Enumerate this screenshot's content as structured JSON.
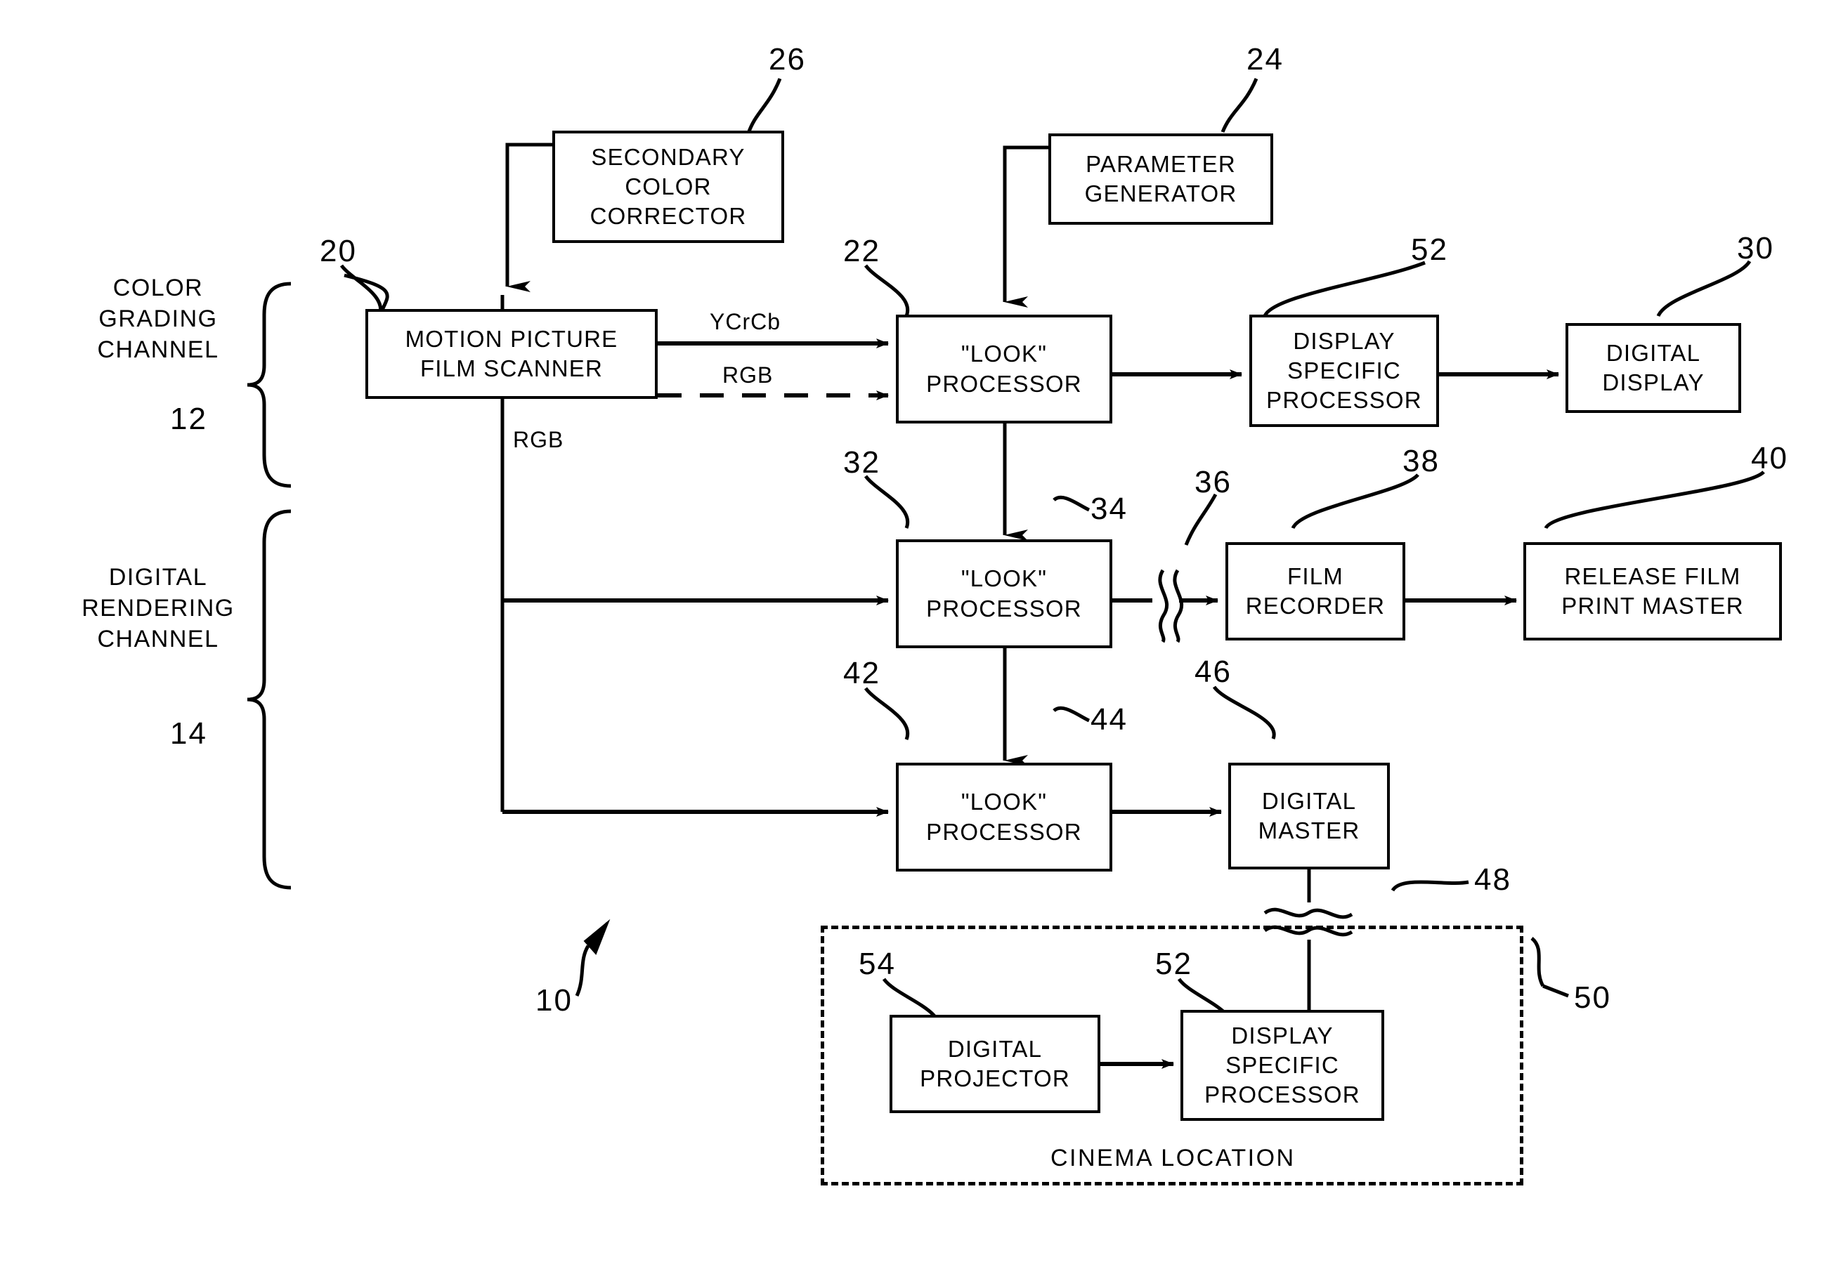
{
  "figure": {
    "id_label": "10",
    "type": "patent-block-diagram"
  },
  "channels": [
    {
      "name": "color-grading",
      "text": "COLOR\nGRADING\nCHANNEL",
      "ref": "12"
    },
    {
      "name": "digital-rendering",
      "text": "DIGITAL\nRENDERING\nCHANNEL",
      "ref": "14"
    }
  ],
  "blocks": [
    {
      "key": "secondary_color_corrector",
      "label": "SECONDARY\nCOLOR\nCORRECTOR",
      "ref": "26"
    },
    {
      "key": "parameter_generator",
      "label": "PARAMETER\nGENERATOR",
      "ref": "24"
    },
    {
      "key": "film_scanner",
      "label": "MOTION PICTURE\nFILM SCANNER",
      "ref": "20"
    },
    {
      "key": "look_processor_1",
      "label": "\"LOOK\"\nPROCESSOR",
      "ref": "22"
    },
    {
      "key": "display_specific_1",
      "label": "DISPLAY\nSPECIFIC\nPROCESSOR",
      "ref": "52"
    },
    {
      "key": "digital_display",
      "label": "DIGITAL\nDISPLAY",
      "ref": "30"
    },
    {
      "key": "look_processor_2",
      "label": "\"LOOK\"\nPROCESSOR",
      "ref": "32"
    },
    {
      "key": "film_recorder",
      "label": "FILM\nRECORDER",
      "ref": "38"
    },
    {
      "key": "release_film_print_master",
      "label": "RELEASE FILM\nPRINT MASTER",
      "ref": "40"
    },
    {
      "key": "look_processor_3",
      "label": "\"LOOK\"\nPROCESSOR",
      "ref": "42"
    },
    {
      "key": "digital_master",
      "label": "DIGITAL\nMASTER",
      "ref": "46"
    },
    {
      "key": "digital_projector",
      "label": "DIGITAL\nPROJECTOR",
      "ref": "54"
    },
    {
      "key": "display_specific_2",
      "label": "DISPLAY\nSPECIFIC\nPROCESSOR",
      "ref": "52"
    }
  ],
  "signals": {
    "ycrcb": "YCrCb",
    "rgb_dashed": "RGB",
    "rgb_trunk": "RGB"
  },
  "connector_refs": {
    "look1_to_look2": "34",
    "look2_to_look3": "44",
    "look2_to_recorder": "36",
    "master_to_cinema": "48"
  },
  "cinema": {
    "title": "CINEMA LOCATION",
    "ref": "50"
  },
  "colors": {
    "ink": "#000000",
    "paper": "#ffffff"
  }
}
